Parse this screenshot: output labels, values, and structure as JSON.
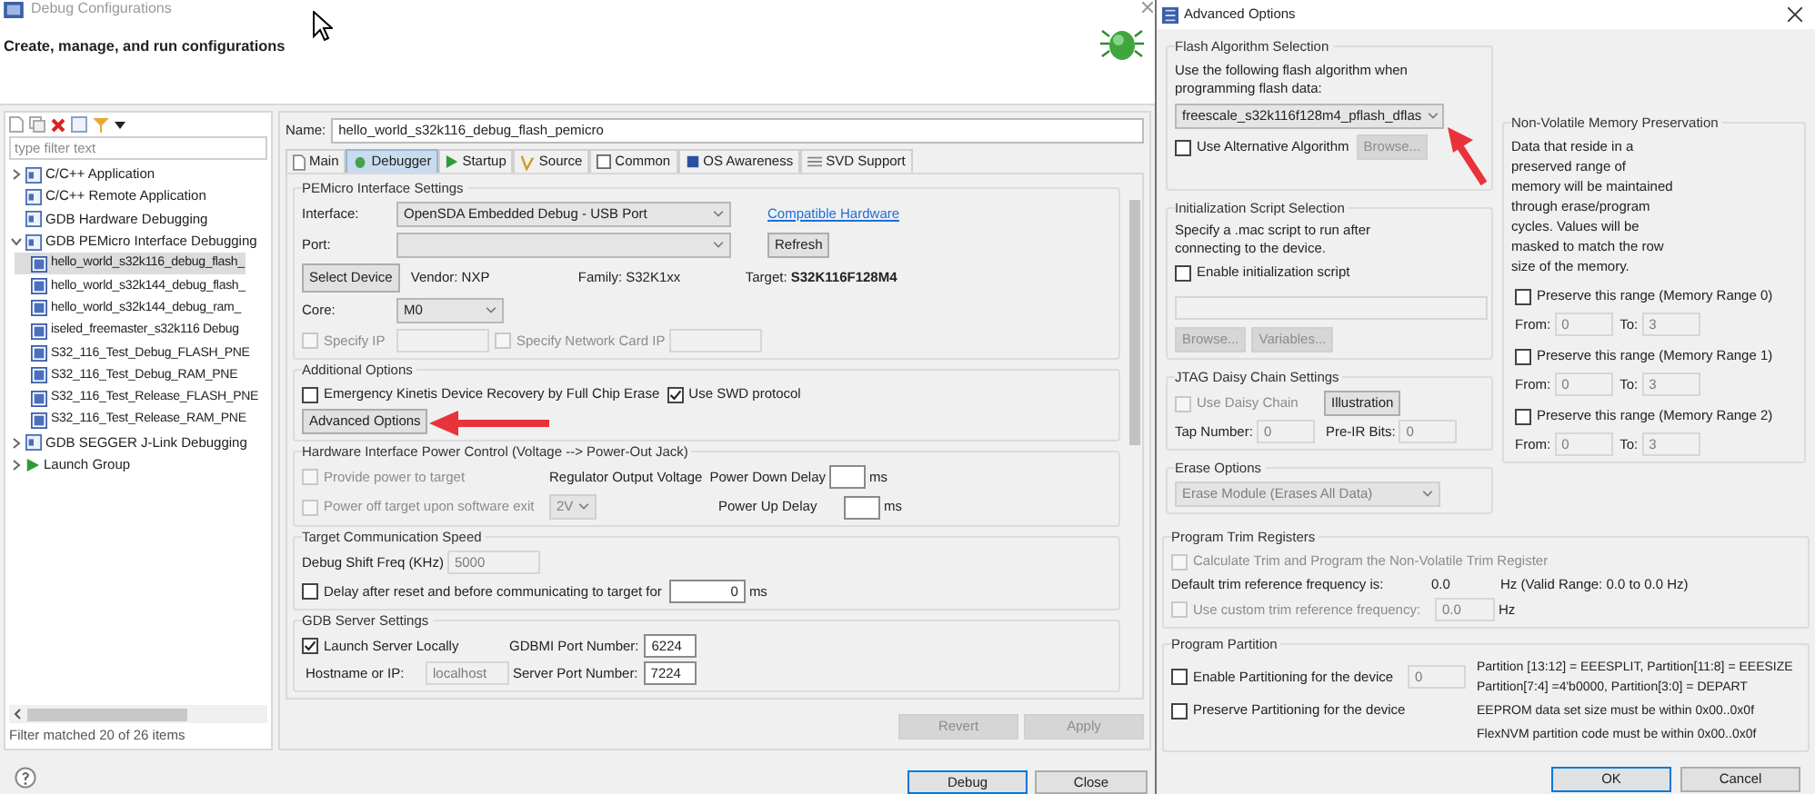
{
  "main_window": {
    "title": "Debug Configurations",
    "subtitle": "Create, manage, and run configurations",
    "filter": {
      "placeholder": "type filter text"
    },
    "tree": [
      {
        "label": "C/C++ Application",
        "kind": "group",
        "expanded": false,
        "selected": false
      },
      {
        "label": "C/C++ Remote Application",
        "kind": "group",
        "selected": false
      },
      {
        "label": "GDB Hardware Debugging",
        "kind": "group",
        "selected": false
      },
      {
        "label": "GDB PEMicro Interface Debugging",
        "kind": "group",
        "expanded": true,
        "selected": false,
        "children": [
          {
            "label": "hello_world_s32k116_debug_flash_",
            "kind": "config",
            "selected": true
          },
          {
            "label": "hello_world_s32k144_debug_flash_",
            "kind": "config",
            "selected": false
          },
          {
            "label": "hello_world_s32k144_debug_ram_",
            "kind": "config",
            "selected": false
          },
          {
            "label": "iseled_freemaster_s32k116 Debug",
            "kind": "config",
            "selected": false
          },
          {
            "label": "S32_116_Test_Debug_FLASH_PNE",
            "kind": "config",
            "selected": false
          },
          {
            "label": "S32_116_Test_Debug_RAM_PNE",
            "kind": "config",
            "selected": false
          },
          {
            "label": "S32_116_Test_Release_FLASH_PNE",
            "kind": "config",
            "selected": false
          },
          {
            "label": "S32_116_Test_Release_RAM_PNE",
            "kind": "config",
            "selected": false
          }
        ]
      },
      {
        "label": "GDB SEGGER J-Link Debugging",
        "kind": "group",
        "expanded": false,
        "selected": false
      },
      {
        "label": "Launch Group",
        "kind": "launch",
        "expanded": false,
        "selected": false
      }
    ],
    "filter_status": "Filter matched 20 of 26 items",
    "name_label": "Name:",
    "name_value": "hello_world_s32k116_debug_flash_pemicro",
    "tabs": [
      {
        "label": "Main",
        "selected": false
      },
      {
        "label": "Debugger",
        "selected": true
      },
      {
        "label": "Startup",
        "selected": false
      },
      {
        "label": "Source",
        "selected": false
      },
      {
        "label": "Common",
        "selected": false
      },
      {
        "label": "OS Awareness",
        "selected": false
      },
      {
        "label": "SVD Support",
        "selected": false
      }
    ],
    "pemicro": {
      "title": "PEMicro Interface Settings",
      "interface_label": "Interface:",
      "interface": {
        "value": "OpenSDA Embedded Debug - USB Port"
      },
      "compatible_link": "Compatible Hardware",
      "port_label": "Port:",
      "refresh": "Refresh",
      "select_device": "Select Device",
      "vendor": "Vendor: NXP",
      "family": "Family: S32K1xx",
      "target": "Target: **S32K116F128M4**",
      "core_label": "Core:",
      "core": {
        "value": "M0"
      },
      "specify_ip": {
        "label": "Specify IP",
        "checked": false,
        "disabled": true
      },
      "ip_field": {
        "disabled": true
      },
      "specify_nic": {
        "label": "Specify Network Card IP",
        "checked": false,
        "disabled": true
      },
      "nic_field": {
        "disabled": true
      }
    },
    "additional": {
      "title": "Additional Options",
      "emergency": {
        "label": "Emergency Kinetis Device Recovery by Full Chip Erase",
        "checked": false
      },
      "swd": {
        "label": "Use SWD protocol",
        "checked": true
      },
      "advanced_button": "Advanced Options"
    },
    "power": {
      "title": "Hardware Interface Power Control (Voltage --> Power-Out Jack)",
      "provide": {
        "label": "Provide power to target",
        "checked": false,
        "disabled": true
      },
      "regulator_label": "Regulator Output Voltage",
      "down_label": "Power Down Delay",
      "down_unit": "ms",
      "power_off": {
        "label": "Power off target upon software exit",
        "checked": false,
        "disabled": true
      },
      "voltage": {
        "value": "2V",
        "disabled": true
      },
      "up_label": "Power Up Delay",
      "up_unit": "ms"
    },
    "speed": {
      "title": "Target Communication Speed",
      "freq_label": "Debug Shift Freq (KHz)",
      "freq": {
        "value": "5000",
        "disabled": true
      },
      "delay": {
        "label": "Delay after reset and before communicating to target for",
        "checked": false
      },
      "delay_field": {
        "value": "0"
      },
      "delay_unit": "ms"
    },
    "gdb": {
      "title": "GDB Server Settings",
      "launch": {
        "label": "Launch Server Locally",
        "checked": true
      },
      "gdbmi_label": "GDBMI Port Number:",
      "gdbmi": {
        "value": "6224"
      },
      "host_label": "Hostname or IP:",
      "host": {
        "value": "localhost",
        "disabled": true
      },
      "server_label": "Server Port Number:",
      "server": {
        "value": "7224"
      }
    },
    "revert": {
      "label": "Revert",
      "disabled": true
    },
    "apply": {
      "label": "Apply",
      "disabled": true
    },
    "debug": "Debug",
    "close": "Close"
  },
  "dialog": {
    "title": "Advanced Options",
    "flash": {
      "title": "Flash Algorithm Selection",
      "text": "Use the following flash algorithm when programming flash data:",
      "algorithm": {
        "value": "freescale_s32k116f128m4_pflash_dflas"
      },
      "alternative": {
        "label": "Use Alternative Algorithm",
        "checked": false
      },
      "browse": {
        "label": "Browse...",
        "disabled": true
      }
    },
    "init": {
      "title": "Initialization Script Selection",
      "text": "Specify a .mac script to run after connecting to the device.",
      "enable": {
        "label": "Enable initialization script",
        "checked": false
      },
      "script_field": {
        "disabled": true
      },
      "browse": {
        "label": "Browse...",
        "disabled": true
      },
      "variables": {
        "label": "Variables...",
        "disabled": true
      }
    },
    "jtag": {
      "title": "JTAG Daisy Chain Settings",
      "daisy": {
        "label": "Use Daisy Chain",
        "checked": false,
        "disabled": true
      },
      "illustration": {
        "label": "Illustration"
      },
      "tap_label": "Tap Number:",
      "tap": {
        "value": "0",
        "disabled": true
      },
      "preir_label": "Pre-IR Bits:",
      "preir": {
        "value": "0",
        "disabled": true
      }
    },
    "erase": {
      "title": "Erase Options",
      "mode": {
        "value": "Erase Module (Erases All Data)",
        "disabled": true
      }
    },
    "nvm": {
      "title": "Non-Volatile Memory Preservation",
      "text": "Data that reside in a preserved range of memory will be maintained through erase/program cycles. Values will be masked to match the row size of the memory.",
      "ranges": [
        {
          "label": "Preserve this range (Memory Range 0)",
          "checked": false,
          "from_label": "From:",
          "from": {
            "value": "0",
            "disabled": true
          },
          "to_label": "To:",
          "to": {
            "value": "3",
            "disabled": true
          }
        },
        {
          "label": "Preserve this range (Memory Range 1)",
          "checked": false,
          "from_label": "From:",
          "from": {
            "value": "0",
            "disabled": true
          },
          "to_label": "To:",
          "to": {
            "value": "3",
            "disabled": true
          }
        },
        {
          "label": "Preserve this range (Memory Range 2)",
          "checked": false,
          "from_label": "From:",
          "from": {
            "value": "0",
            "disabled": true
          },
          "to_label": "To:",
          "to": {
            "value": "3",
            "disabled": true
          }
        }
      ]
    },
    "trim": {
      "title": "Program Trim Registers",
      "calculate": {
        "label": "Calculate Trim and Program the Non-Volatile Trim Register",
        "checked": false,
        "disabled": true
      },
      "default_label": "Default trim reference frequency is:",
      "default_value": "0.0",
      "default_range": "Hz (Valid Range: 0.0 to 0.0 Hz)",
      "custom": {
        "label": "Use custom trim reference frequency:",
        "checked": false,
        "disabled": true
      },
      "custom_field": {
        "value": "0.0",
        "disabled": true
      },
      "custom_unit": "Hz"
    },
    "partition": {
      "title": "Program Partition",
      "enable": {
        "label": "Enable Partitioning for the device",
        "checked": false
      },
      "enable_field": {
        "value": "0",
        "disabled": true
      },
      "preserve": {
        "label": "Preserve Partitioning for the device",
        "checked": false
      },
      "notes": [
        "Partition [13:12] = EEESPLIT, Partition[11:8] = EEESIZE",
        "Partition[7:4] =4'b0000, Partition[3:0] = DEPART",
        "EEPROM data set size must be within 0x00..0x0f",
        "FlexNVM partition code must be within 0x00..0x0f"
      ]
    },
    "ok": "OK",
    "cancel": "Cancel"
  }
}
